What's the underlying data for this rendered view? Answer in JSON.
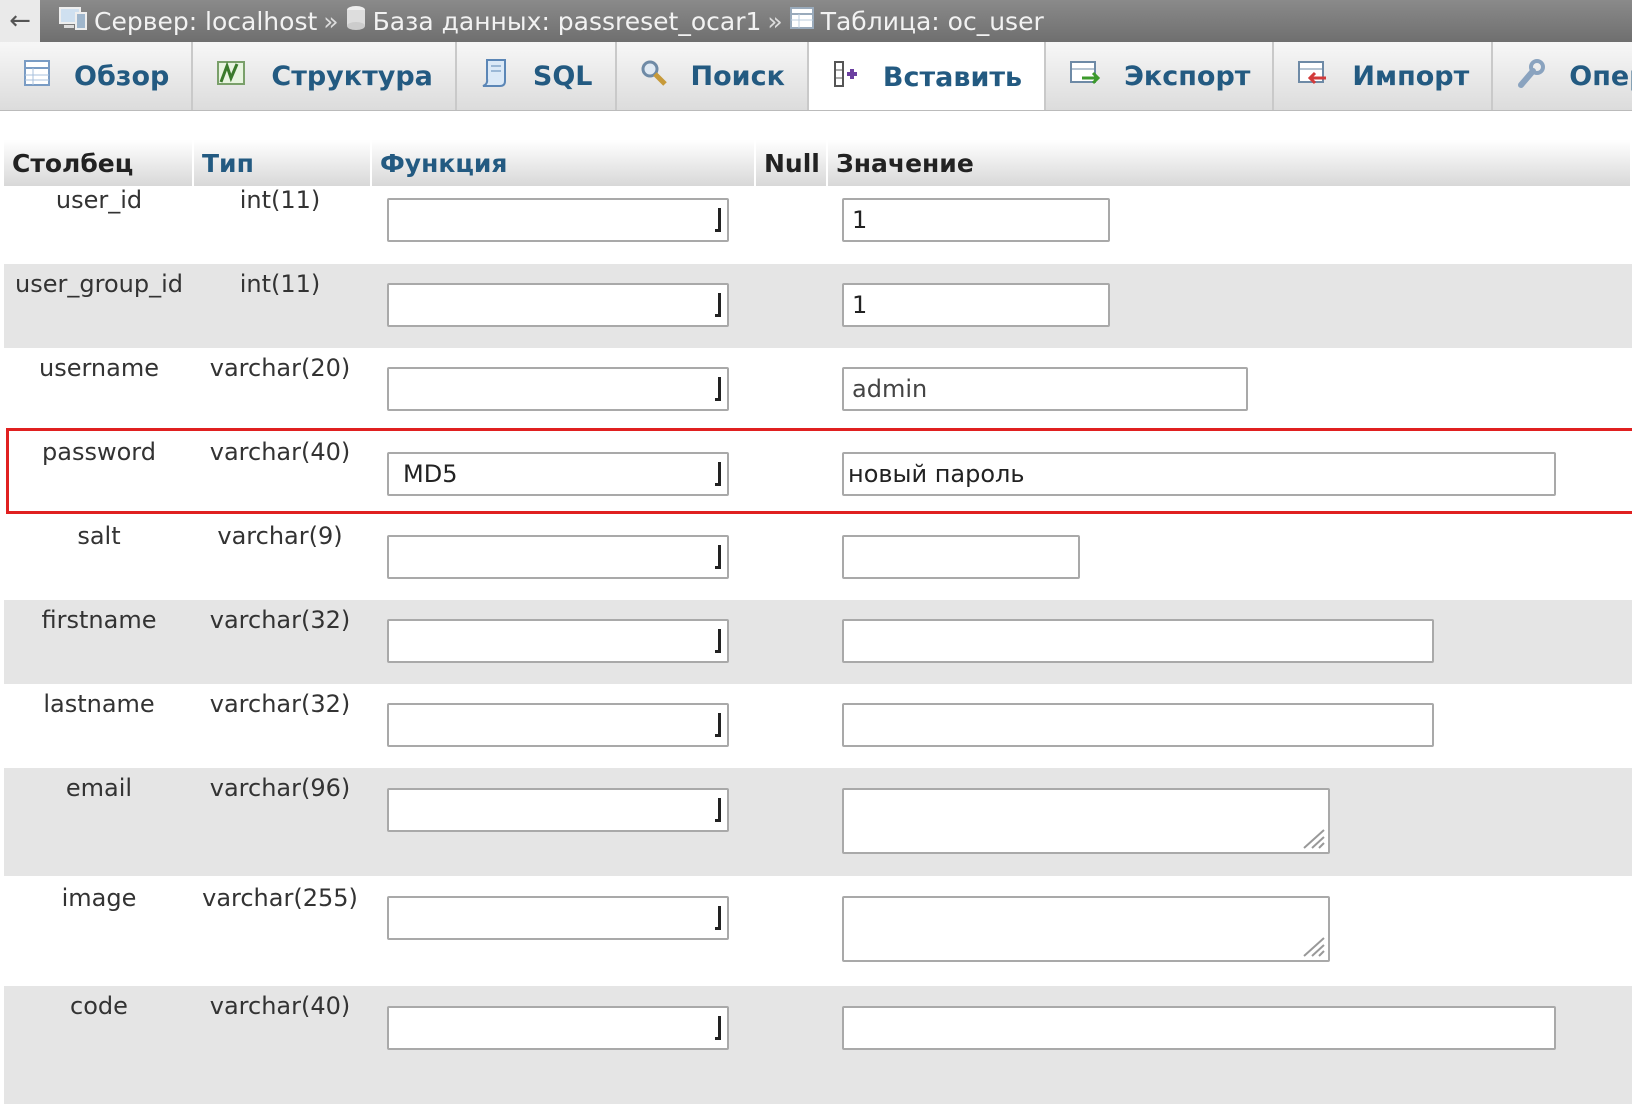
{
  "breadcrumb": {
    "back_symbol": "←",
    "server": "Сервер: localhost",
    "separator": "»",
    "database": "База данных: passreset_ocar1",
    "table": "Таблица: oc_user"
  },
  "tabs": [
    {
      "label": "Обзор",
      "icon": "table-icon"
    },
    {
      "label": "Структура",
      "icon": "structure-icon"
    },
    {
      "label": "SQL",
      "icon": "sql-icon"
    },
    {
      "label": "Поиск",
      "icon": "search-icon"
    },
    {
      "label": "Вставить",
      "icon": "insert-icon",
      "active": true
    },
    {
      "label": "Экспорт",
      "icon": "export-icon"
    },
    {
      "label": "Импорт",
      "icon": "import-icon"
    },
    {
      "label": "Опера",
      "icon": "wrench-icon"
    }
  ],
  "columns": {
    "column": "Столбец",
    "type": "Тип",
    "function": "Функция",
    "null": "Null",
    "value": "Значение"
  },
  "rows": [
    {
      "name": "user_id",
      "type": "int(11)",
      "function": "",
      "value": "1"
    },
    {
      "name": "user_group_id",
      "type": "int(11)",
      "function": "",
      "value": "1"
    },
    {
      "name": "username",
      "type": "varchar(20)",
      "function": "",
      "value": "admin"
    },
    {
      "name": "password",
      "type": "varchar(40)",
      "function": "MD5",
      "value": "новый пароль"
    },
    {
      "name": "salt",
      "type": "varchar(9)",
      "function": "",
      "value": ""
    },
    {
      "name": "firstname",
      "type": "varchar(32)",
      "function": "",
      "value": ""
    },
    {
      "name": "lastname",
      "type": "varchar(32)",
      "function": "",
      "value": ""
    },
    {
      "name": "email",
      "type": "varchar(96)",
      "function": "",
      "value": ""
    },
    {
      "name": "image",
      "type": "varchar(255)",
      "function": "",
      "value": ""
    },
    {
      "name": "code",
      "type": "varchar(40)",
      "function": "",
      "value": ""
    }
  ],
  "colors": {
    "link": "#235a81",
    "highlight": "#e02020",
    "row_alt": "#e5e5e5"
  }
}
